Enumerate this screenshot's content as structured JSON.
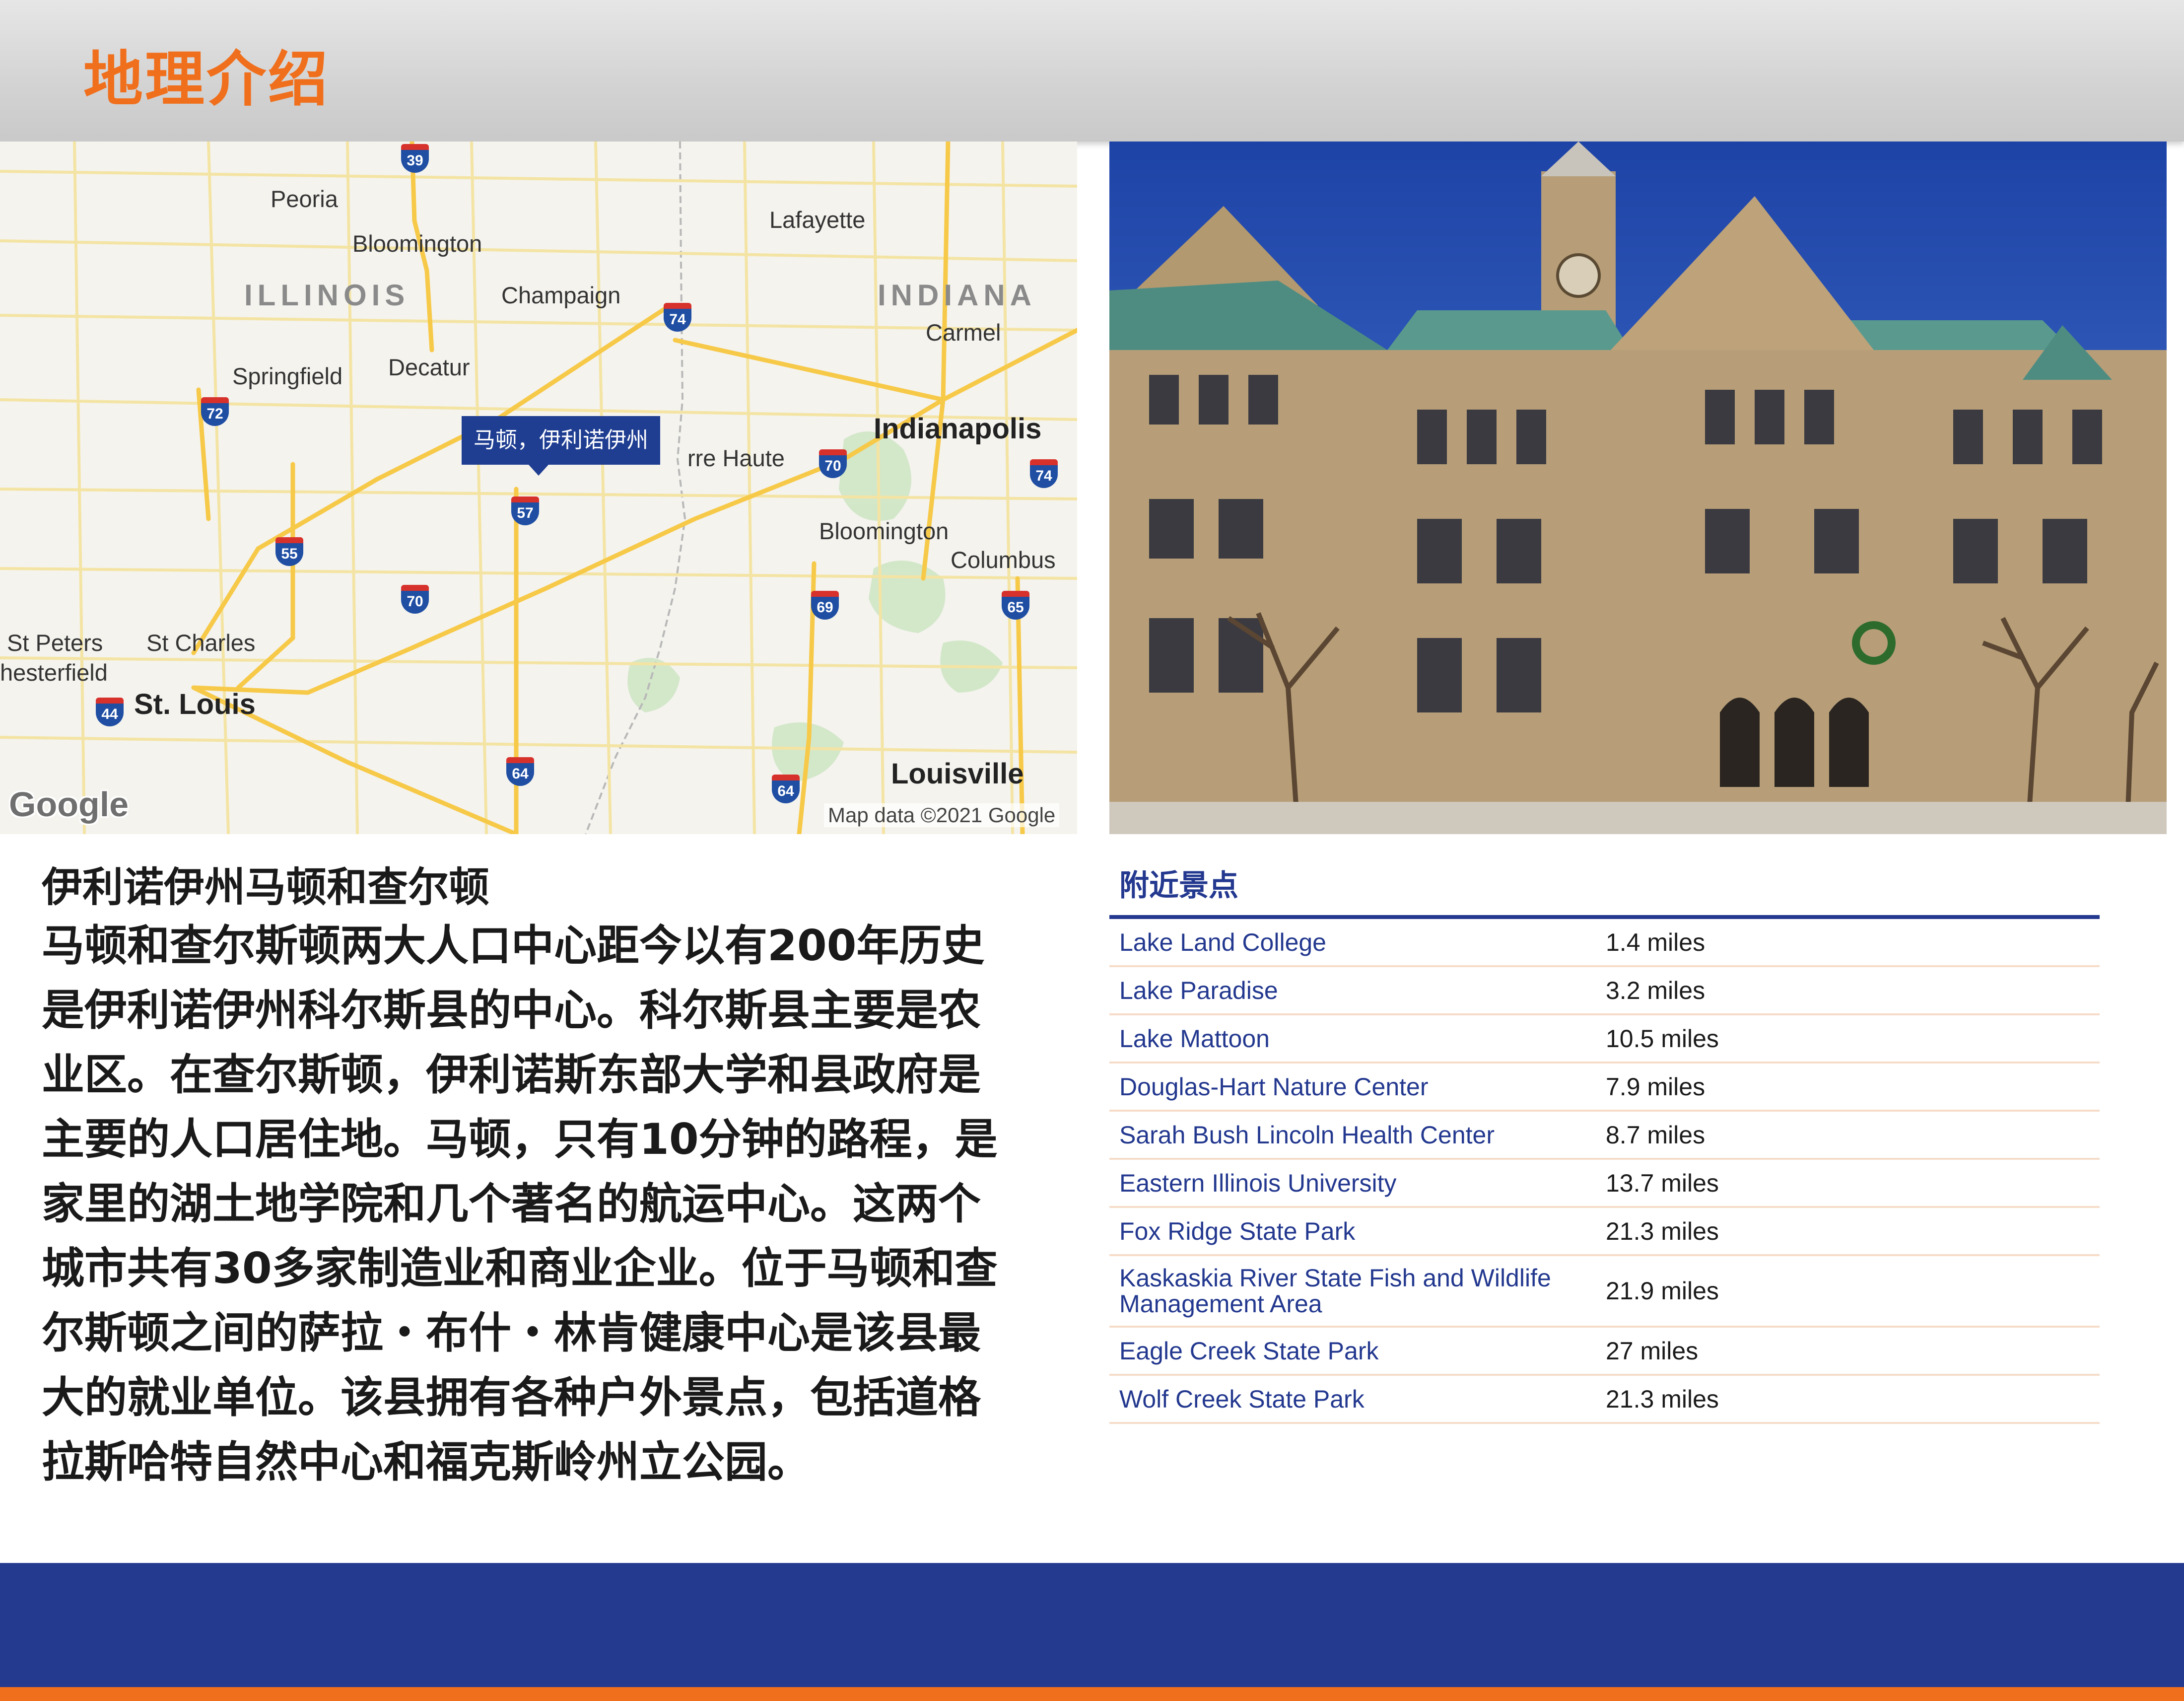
{
  "header": {
    "title": "地理介绍"
  },
  "map": {
    "states": [
      "ILLINOIS",
      "INDIANA"
    ],
    "cities": [
      "Peoria",
      "Lafayette",
      "Bloomington",
      "Champaign",
      "Carmel",
      "Springfield",
      "Decatur",
      "Indianapolis",
      "rre Haute",
      "Bloomington",
      "Columbus",
      "St Peters",
      "St Charles",
      "hesterfield",
      "St. Louis",
      "Louisville"
    ],
    "interstates": [
      "39",
      "74",
      "72",
      "70",
      "74",
      "57",
      "55",
      "70",
      "69",
      "65",
      "44",
      "64",
      "64"
    ],
    "marker_label": "马顿，伊利诺伊州",
    "logo": "Google",
    "attribution": "Map data ©2021 Google"
  },
  "text": {
    "section_title": "伊利诺伊州马顿和查尔顿",
    "lines": [
      "马顿和查尔斯顿两大人口中心距今以有200年历史",
      "是伊利诺伊州科尔斯县的中心。科尔斯县主要是农",
      "业区。在查尔斯顿，伊利诺斯东部大学和县政府是",
      "主要的人口居住地。马顿，只有10分钟的路程，是",
      "家里的湖土地学院和几个著名的航运中心。这两个",
      "城市共有30多家制造业和商业企业。位于马顿和查",
      "尔斯顿之间的萨拉・布什・林肯健康中心是该县最",
      "大的就业单位。该县拥有各种户外景点，包括道格",
      "拉斯哈特自然中心和福克斯岭州立公园。"
    ]
  },
  "nearby": {
    "title": "附近景点",
    "rows": [
      {
        "name": "Lake Land College",
        "distance": "1.4 miles"
      },
      {
        "name": "Lake Paradise",
        "distance": "3.2 miles"
      },
      {
        "name": "Lake Mattoon",
        "distance": "10.5 miles"
      },
      {
        "name": "Douglas-Hart Nature Center",
        "distance": "7.9 miles"
      },
      {
        "name": "Sarah Bush Lincoln Health Center",
        "distance": "8.7 miles"
      },
      {
        "name": "Eastern Illinois University",
        "distance": "13.7 miles"
      },
      {
        "name": "Fox Ridge State Park",
        "distance": "21.3 miles"
      },
      {
        "name": "Kaskaskia River State Fish and Wildlife Management Area",
        "distance": "21.9 miles"
      },
      {
        "name": "Eagle Creek State Park",
        "distance": "27 miles"
      },
      {
        "name": "Wolf Creek State Park",
        "distance": "21.3 miles"
      }
    ]
  },
  "colors": {
    "accent_orange": "#f06f1c",
    "navy": "#233a8f",
    "link_blue": "#23388f"
  }
}
